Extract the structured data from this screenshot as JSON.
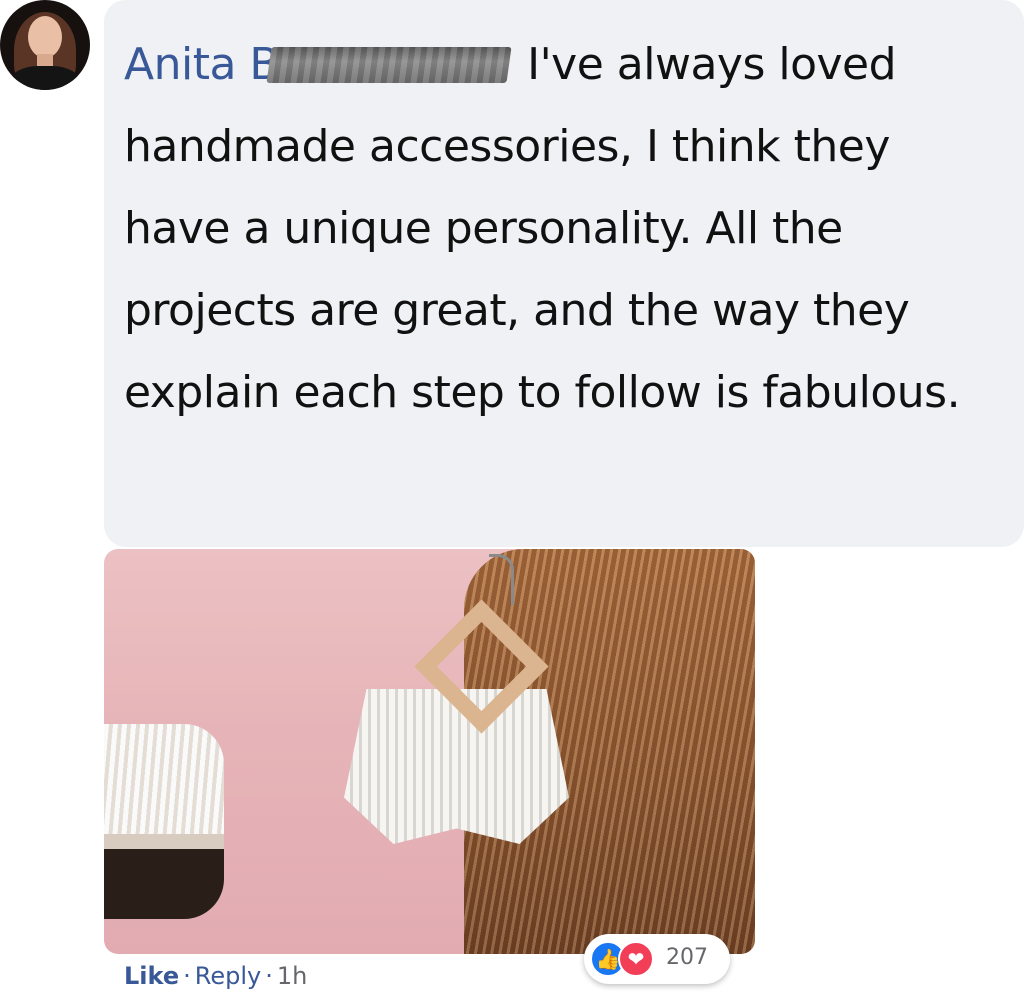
{
  "comment": {
    "author_visible": "Anita B",
    "author_redacted": true,
    "text": "I've always loved handmade accessories, I think they have a unique personality. All the projects are great, and the way they explain each step to follow is fabulous."
  },
  "actions": {
    "like_label": "Like",
    "reply_label": "Reply",
    "separator": "·",
    "time": "1h"
  },
  "reactions": {
    "count": "207",
    "icons": [
      "thumbs-up-icon",
      "heart-icon"
    ],
    "like_color": "#1877f2",
    "love_color": "#f33e58"
  },
  "colors": {
    "author_link": "#385898",
    "bubble_bg": "#eff1f4"
  }
}
